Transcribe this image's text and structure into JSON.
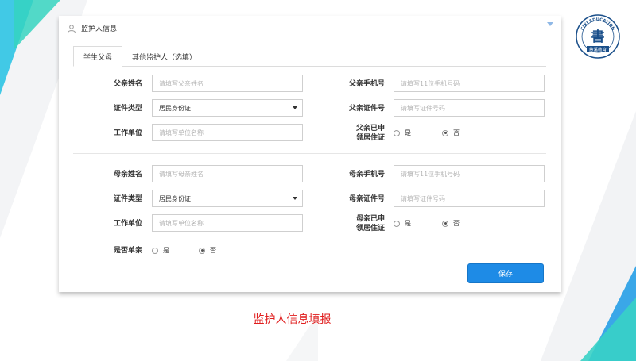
{
  "panel": {
    "title": "监护人信息",
    "tabs": [
      {
        "label": "学生父母",
        "active": true
      },
      {
        "label": "其他监护人（选填）",
        "active": false
      }
    ]
  },
  "father": {
    "name_label": "父亲姓名",
    "name_placeholder": "请填写父亲姓名",
    "phone_label": "父亲手机号",
    "phone_placeholder": "请填写11位手机号码",
    "id_type_label": "证件类型",
    "id_type_value": "居民身份证",
    "id_number_label": "父亲证件号",
    "id_number_placeholder": "请填写证件号码",
    "work_label": "工作单位",
    "work_placeholder": "请填写单位名称",
    "residence_label_line1": "父亲已申",
    "residence_label_line2": "领居住证",
    "residence_yes": "是",
    "residence_no": "否",
    "residence_selected": "否"
  },
  "mother": {
    "name_label": "母亲姓名",
    "name_placeholder": "请填写母亲姓名",
    "phone_label": "母亲手机号",
    "phone_placeholder": "请填写11位手机号码",
    "id_type_label": "证件类型",
    "id_type_value": "居民身份证",
    "id_number_label": "母亲证件号",
    "id_number_placeholder": "请填写证件号码",
    "work_label": "工作单位",
    "work_placeholder": "请填写单位名称",
    "residence_label_line1": "母亲已申",
    "residence_label_line2": "领居住证",
    "residence_yes": "是",
    "residence_no": "否",
    "residence_selected": "否"
  },
  "single_parent": {
    "label": "是否单亲",
    "yes": "是",
    "no": "否",
    "selected": "否"
  },
  "actions": {
    "save_label": "保存"
  },
  "caption": "监护人信息填报",
  "logo": {
    "text_top": "CIXI EDUCATION",
    "text_bottom": "慈溪教育",
    "glyph": "書"
  },
  "colors": {
    "primary": "#1e8be6",
    "caption": "#e01d1d",
    "logo": "#1a4f8a"
  }
}
